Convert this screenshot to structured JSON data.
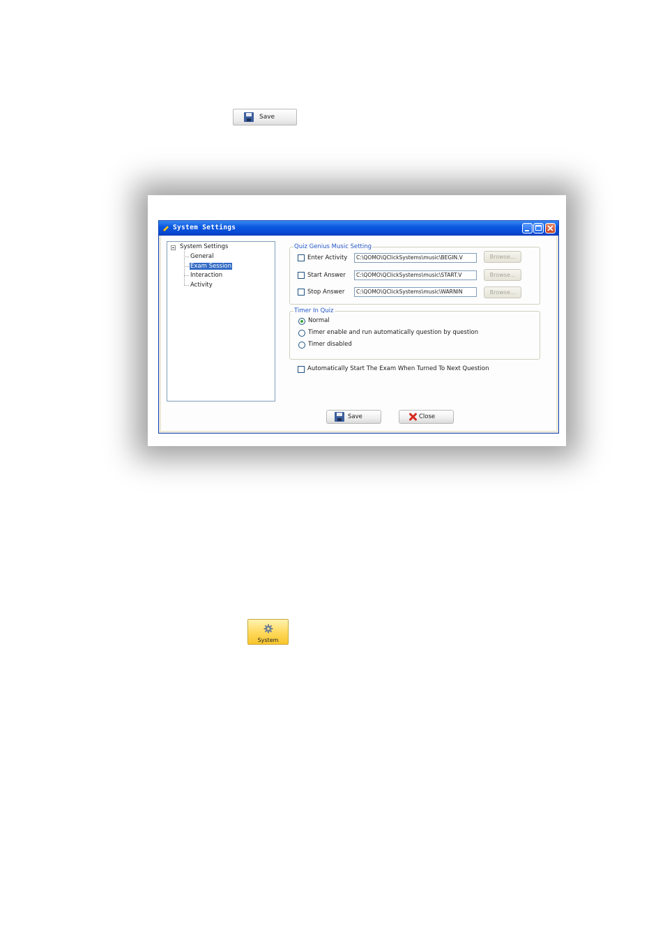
{
  "top_button": {
    "label": "Save",
    "icon": "floppy-disk-icon"
  },
  "dialog": {
    "title": "System Settings",
    "tree": {
      "root": "System Settings",
      "children": [
        "General",
        "Exam Session",
        "Interaction",
        "Activity"
      ],
      "selected": "Exam Session"
    },
    "music_group": {
      "legend": "Quiz Genius Music Setting",
      "rows": [
        {
          "label": "Enter Activity",
          "path": "C:\\QOMO\\QClickSystems\\music\\BEGIN.V",
          "browse": "Browse...",
          "checked": false
        },
        {
          "label": "Start Answer",
          "path": "C:\\QOMO\\QClickSystems\\music\\START.V",
          "browse": "Browse...",
          "checked": false
        },
        {
          "label": "Stop Answer",
          "path": "C:\\QOMO\\QClickSystems\\music\\WARNIN",
          "browse": "Browse...",
          "checked": false
        }
      ]
    },
    "timer_group": {
      "legend": "Timer In Quiz",
      "options": [
        "Normal",
        "Timer enable and run automatically question by question",
        "Timer disabled"
      ],
      "selected": "Normal"
    },
    "auto_start": {
      "label": "Automatically Start The Exam When Turned To Next Question",
      "checked": false
    },
    "buttons": {
      "save": "Save",
      "close": "Close"
    }
  },
  "system_button": {
    "label": "System",
    "icon": "gear-icon"
  },
  "colors": {
    "titlebar": "#0a58e0",
    "selection": "#316ac5",
    "legend_text": "#2456c6",
    "system_button": "#ffd85a"
  }
}
